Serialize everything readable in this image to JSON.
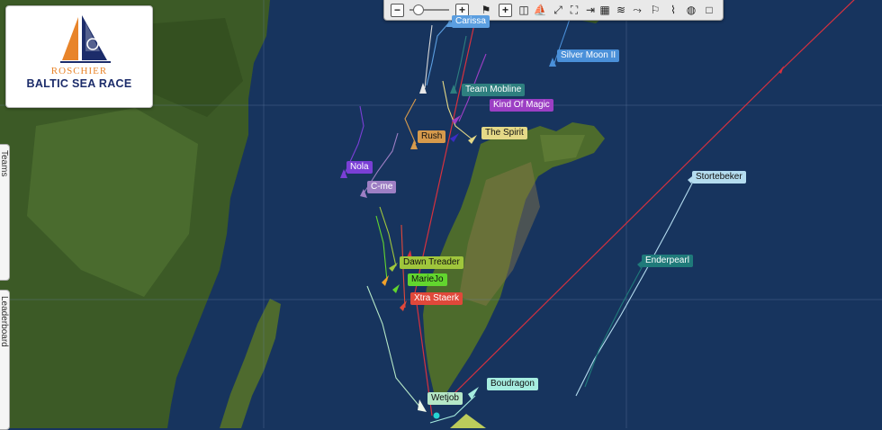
{
  "logo": {
    "subtitle": "ROSCHIER",
    "title": "BALTIC SEA RACE",
    "colors": {
      "navy": "#1c2c6a",
      "orange": "#e8842a"
    }
  },
  "toolbar": {
    "items": [
      {
        "name": "zoom-out-icon",
        "glyph": "−"
      },
      {
        "name": "zoom-in-icon",
        "glyph": "+"
      },
      {
        "name": "race-flag-icon",
        "glyph": "⚑"
      },
      {
        "name": "add-icon",
        "glyph": "+"
      },
      {
        "name": "layers-icon",
        "glyph": "◫"
      },
      {
        "name": "fleet-icon",
        "glyph": "⛵"
      },
      {
        "name": "fit-bounds-icon",
        "glyph": "⤢"
      },
      {
        "name": "fullscreen-icon",
        "glyph": "⛶"
      },
      {
        "name": "exit-icon",
        "glyph": "⇥"
      },
      {
        "name": "grid-icon",
        "glyph": "▦"
      },
      {
        "name": "wind-icon",
        "glyph": "≋"
      },
      {
        "name": "route-icon",
        "glyph": "⤳"
      },
      {
        "name": "waypoint-flags-icon",
        "glyph": "⚐"
      },
      {
        "name": "chart-icon",
        "glyph": "⌇"
      },
      {
        "name": "globe-icon",
        "glyph": "◍"
      },
      {
        "name": "settings-icon",
        "glyph": "□"
      }
    ]
  },
  "side_tabs": [
    "Teams",
    "Leaderboard"
  ],
  "colors": {
    "sea": "#17345e",
    "land": "#3c5a26",
    "rhumb": "#d6313f"
  },
  "boats": [
    {
      "name": "Carissa",
      "color": "#5b9ee0",
      "text": "#ffffff"
    },
    {
      "name": "Silver Moon II",
      "color": "#4a90d9",
      "text": "#ffffff"
    },
    {
      "name": "Team Mobline",
      "color": "#2e7f7f",
      "text": "#ffffff"
    },
    {
      "name": "Kind Of Magic",
      "color": "#9c3fc4",
      "text": "#ffffff"
    },
    {
      "name": "Rush",
      "color": "#d69a4c",
      "text": "#111111"
    },
    {
      "name": "The Spirit",
      "color": "#e5d987",
      "text": "#111111"
    },
    {
      "name": "Nola",
      "color": "#7a3fd6",
      "text": "#ffffff"
    },
    {
      "name": "C-me",
      "color": "#9e7fc4",
      "text": "#ffffff"
    },
    {
      "name": "Stortebeker",
      "color": "#b4dcef",
      "text": "#111111"
    },
    {
      "name": "Enderpearl",
      "color": "#1f7a7a",
      "text": "#ffffff"
    },
    {
      "name": "Dawn Treader",
      "color": "#a0c63c",
      "text": "#111111"
    },
    {
      "name": "MarieJo",
      "color": "#62d62e",
      "text": "#111111"
    },
    {
      "name": "Xtra Staerk",
      "color": "#e0483a",
      "text": "#ffffff"
    },
    {
      "name": "Wetjob",
      "color": "#b5e7c7",
      "text": "#111111"
    },
    {
      "name": "Boudragon",
      "color": "#a6ede0",
      "text": "#111111"
    }
  ]
}
